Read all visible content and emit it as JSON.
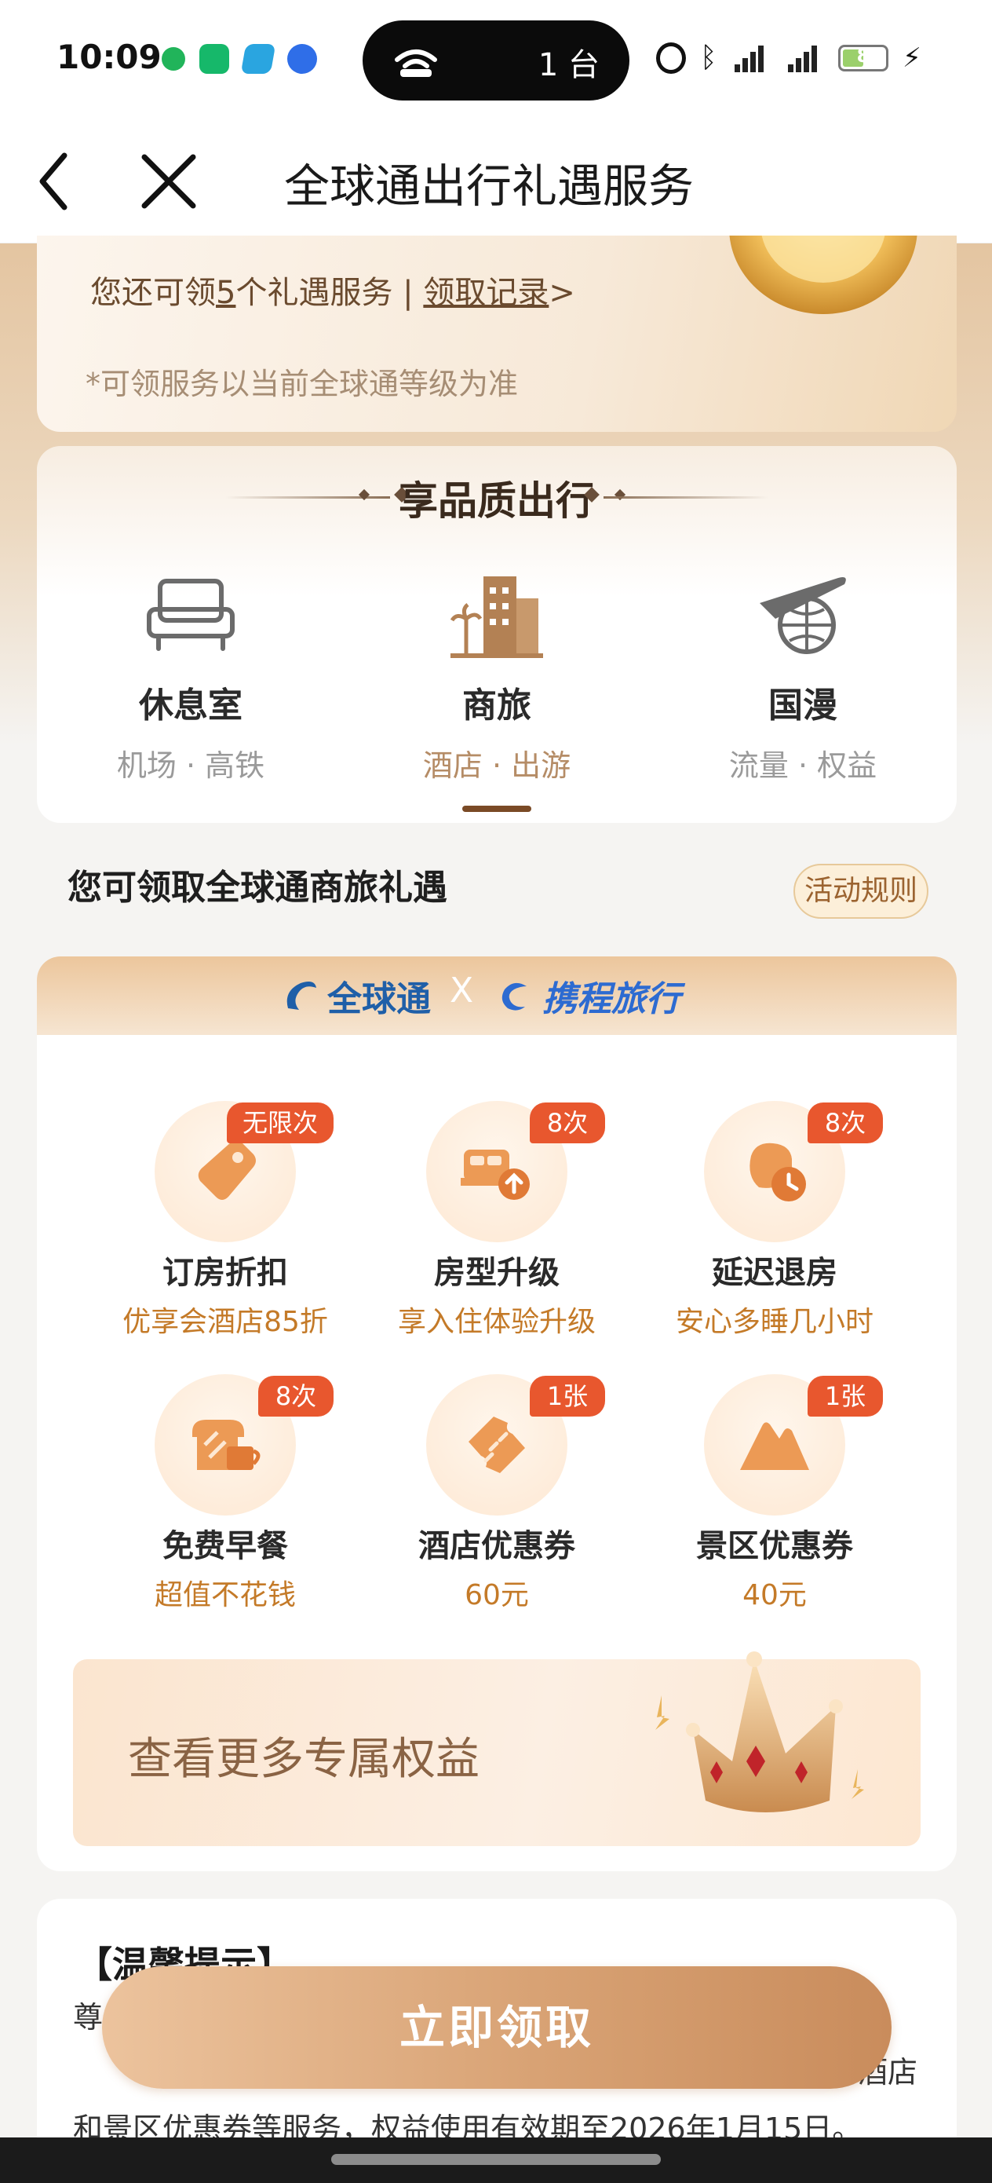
{
  "status_bar": {
    "time": "10:09",
    "island_text": "1 台",
    "battery_level": "8"
  },
  "nav": {
    "title": "全球通出行礼遇服务"
  },
  "summary": {
    "prefix": "您还可领",
    "count": "5",
    "suffix": "个礼遇服务 | ",
    "record_link": "领取记录",
    "record_arrow": ">",
    "note": "*可领服务以当前全球通等级为准"
  },
  "quality": {
    "title": "享品质出行",
    "categories": [
      {
        "name": "休息室",
        "sub": "机场 · 高铁",
        "icon": "sofa-icon"
      },
      {
        "name": "商旅",
        "sub": "酒店 · 出游",
        "icon": "hotel-icon",
        "active": true
      },
      {
        "name": "国漫",
        "sub": "流量 · 权益",
        "icon": "plane-globe-icon"
      }
    ]
  },
  "section": {
    "title": "您可领取全球通商旅礼遇",
    "rules": "活动规则"
  },
  "brand": {
    "left": "全球通",
    "x": "X",
    "right": "携程旅行"
  },
  "perks": [
    {
      "badge": "无限次",
      "name": "订房折扣",
      "desc": "优享会酒店85折",
      "icon": "tag-icon"
    },
    {
      "badge": "8次",
      "name": "房型升级",
      "desc": "享入住体验升级",
      "icon": "bed-upgrade-icon"
    },
    {
      "badge": "8次",
      "name": "延迟退房",
      "desc": "安心多睡几小时",
      "icon": "late-checkout-icon"
    },
    {
      "badge": "8次",
      "name": "免费早餐",
      "desc": "超值不花钱",
      "icon": "breakfast-icon"
    },
    {
      "badge": "1张",
      "name": "酒店优惠券",
      "desc": "60元",
      "icon": "hotel-coupon-icon"
    },
    {
      "badge": "1张",
      "name": "景区优惠券",
      "desc": "40元",
      "icon": "scenic-coupon-icon"
    }
  ],
  "more": {
    "label": "查看更多专属权益"
  },
  "tips": {
    "title": "【温馨提示】",
    "line1": "尊",
    "line1_end": "酒店",
    "line2": "和景区优惠券等服务，权益使用有效期至2026年1月15日。"
  },
  "cta": {
    "label": "立即领取"
  },
  "colors": {
    "accent_brown": "#7a4a26",
    "badge_red": "#e8572e",
    "desc_orange": "#c47a28",
    "cta_gold": "#d8a274"
  }
}
